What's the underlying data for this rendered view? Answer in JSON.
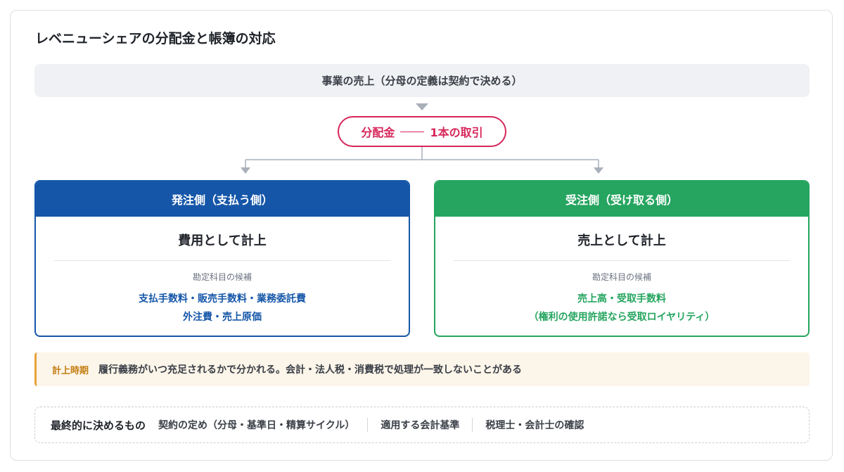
{
  "title": "レベニューシェアの分配金と帳簿の対応",
  "source": "事業の売上（分母の定義は契約で決める）",
  "pill": {
    "left": "分配金",
    "right": "1本の取引"
  },
  "left_box": {
    "header": "発注側（支払う側）",
    "main": "費用として計上",
    "sub": "勘定科目の候補",
    "line1": "支払手数料・販売手数料・業務委託費",
    "line2": "外注費・売上原価"
  },
  "right_box": {
    "header": "受注側（受け取る側）",
    "main": "売上として計上",
    "sub": "勘定科目の候補",
    "line1": "売上高・受取手数料",
    "line2": "（権利の使用許諾なら受取ロイヤリティ）"
  },
  "note": {
    "label": "計上時期",
    "text": "履行義務がいつ充足されるかで分かれる。会計・法人税・消費税で処理が一致しないことがある"
  },
  "final": {
    "label": "最終的に決めるもの",
    "items": [
      "契約の定め（分母・基準日・精算サイクル）",
      "適用する会計基準",
      "税理士・会計士の確認"
    ]
  },
  "colors": {
    "pill": "#d6265a",
    "left": "#1556a8",
    "right": "#25a55f",
    "note_accent": "#e8a23b",
    "connector": "#a9b0ba"
  }
}
